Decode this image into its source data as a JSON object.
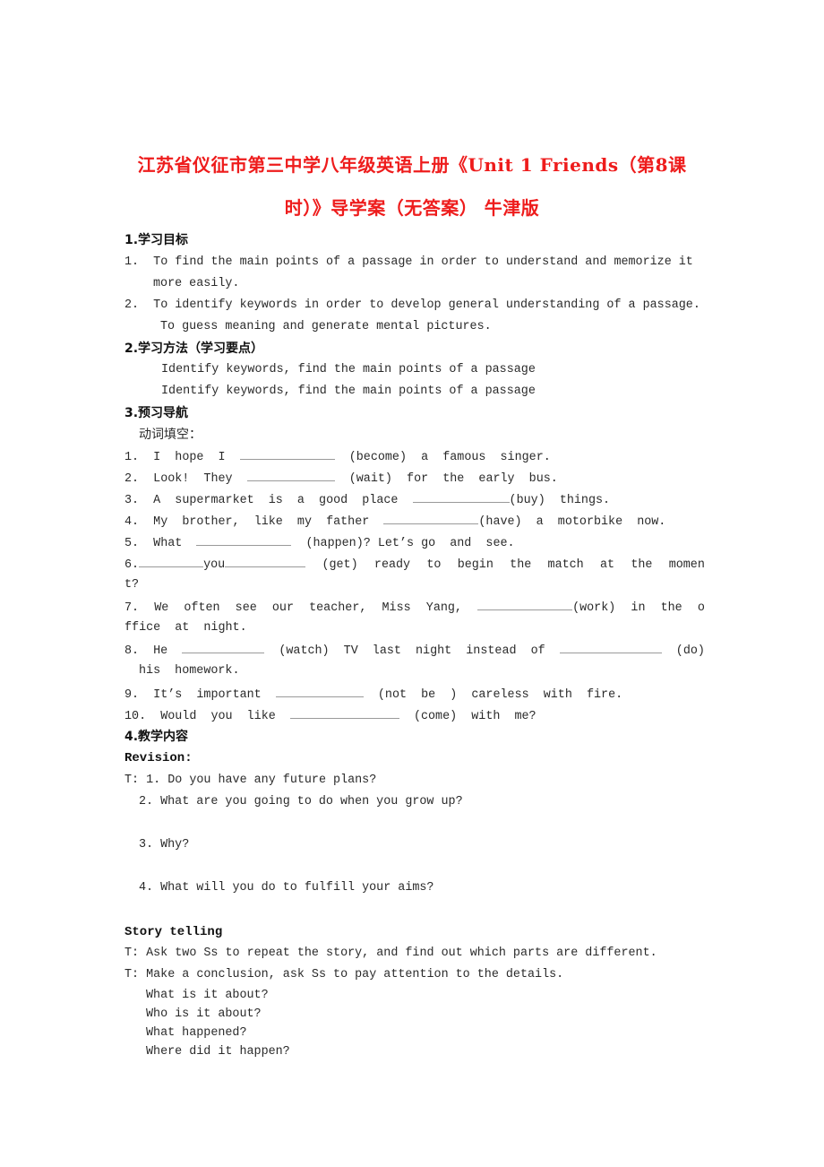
{
  "title": {
    "line1": "江苏省仪征市第三中学八年级英语上册《Unit 1 Friends（第8课",
    "line2": "时）》导学案（无答案） 牛津版",
    "color": "#ee1c1c"
  },
  "section1": {
    "heading": "1.学习目标",
    "items": [
      {
        "num": "1.",
        "text": "To find the main points of a passage in order to understand and memorize it",
        "cont": "more easily."
      },
      {
        "num": "2.",
        "text": "To identify keywords in order to develop general understanding of a passage.",
        "cont": "To guess meaning and generate mental pictures."
      }
    ]
  },
  "section2": {
    "heading": "2.学习方法（学习要点）",
    "lines": [
      "Identify keywords, find the main points of a passage",
      "Identify keywords, find the main points of a passage"
    ]
  },
  "section3": {
    "heading": "3.预习导航",
    "subheading": "动词填空：",
    "items": [
      {
        "num": "1.",
        "words": [
          "I",
          "hope",
          "I"
        ],
        "verb": "(become)",
        "after": [
          "a",
          "famous",
          "singer."
        ]
      },
      {
        "num": "2.",
        "words": [
          "Look!",
          "They"
        ],
        "verb": "(wait)",
        "after": [
          "for",
          "the",
          "early",
          "bus."
        ]
      },
      {
        "num": "3.",
        "words": [
          "A",
          "supermarket",
          "is",
          "a",
          "good",
          "place"
        ],
        "verb": "(buy)",
        "after": [
          "things."
        ]
      },
      {
        "num": "4.",
        "words": [
          "My",
          "brother,",
          "like",
          "my",
          "father"
        ],
        "verb": "(have)",
        "after": [
          "a",
          "motorbike",
          "now."
        ]
      },
      {
        "num": "5.",
        "words": [
          "What"
        ],
        "verb": "(happen)?",
        "after": [
          "Let’s",
          "go",
          "and",
          "see."
        ]
      },
      {
        "num": "6.",
        "mid": "you",
        "verb": "(get)",
        "after": [
          "ready",
          "to",
          "begin",
          "the",
          "match",
          "at",
          "the",
          "momen"
        ],
        "cont": "t?"
      },
      {
        "num": "7.",
        "words": [
          "We",
          "often",
          "see",
          "our",
          "teacher,",
          "Miss",
          "Yang,"
        ],
        "verb": "(work)",
        "after": [
          "in",
          "the",
          "o"
        ],
        "cont": "ffice  at  night."
      },
      {
        "num": "8.",
        "words": [
          "He"
        ],
        "verb": "(watch)",
        "after": [
          "TV",
          "last",
          "night",
          "instead",
          "of"
        ],
        "verb2": "(do)",
        "cont": "his  homework."
      },
      {
        "num": "9.",
        "words": [
          "It’s",
          "important"
        ],
        "verb": "(not  be  )",
        "after": [
          "careless",
          "with",
          "fire."
        ]
      },
      {
        "num": "10.",
        "words": [
          "Would",
          "you",
          "like"
        ],
        "verb": "(come)",
        "after": [
          "with",
          "me?"
        ]
      }
    ]
  },
  "section4": {
    "heading": "4.教学内容",
    "revision": {
      "label": "Revision:",
      "questions": [
        "T: 1. Do you have any future plans?",
        "2. What are you going to do when you grow up?",
        "3. Why?",
        "4. What will you do to fulfill your aims?"
      ]
    },
    "story": {
      "label": "Story telling",
      "lines": [
        "T: Ask two Ss to repeat the story, and find out which parts are different.",
        "T: Make a conclusion, ask Ss to pay attention to the details."
      ],
      "questions": [
        "What is it about?",
        "Who is it about?",
        "What happened?",
        "Where did it happen?"
      ]
    }
  }
}
